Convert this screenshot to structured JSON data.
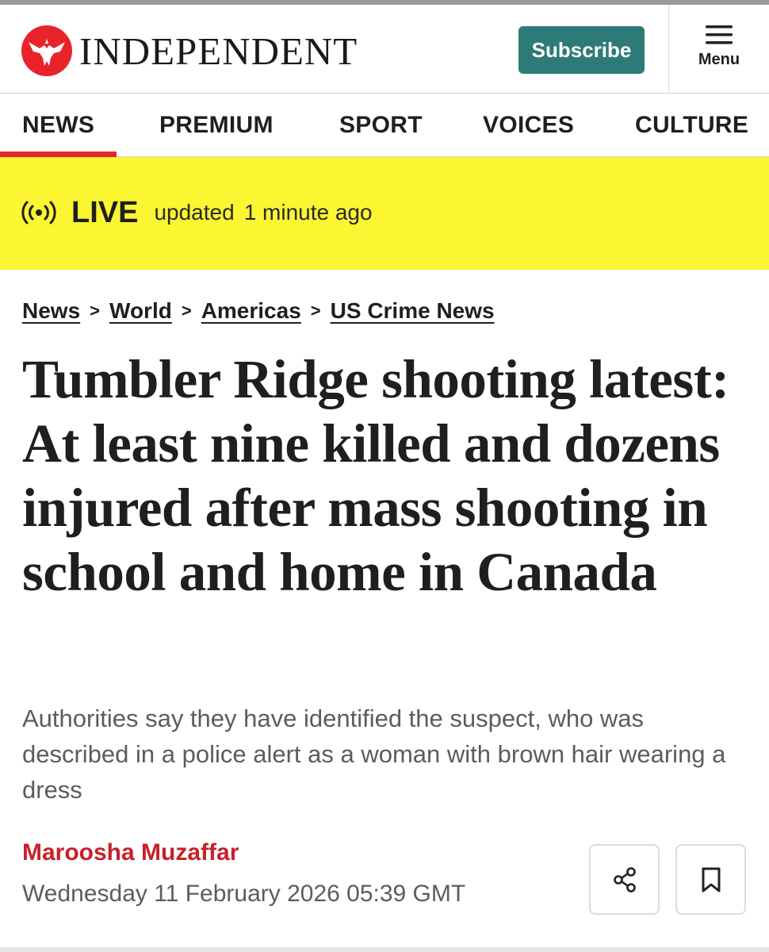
{
  "header": {
    "logo_text": "INDEPENDENT",
    "logo_icon": "eagle-logo-icon",
    "subscribe_label": "Subscribe",
    "menu_label": "Menu",
    "menu_icon": "hamburger-icon"
  },
  "nav": {
    "items": [
      {
        "label": "NEWS",
        "active": true
      },
      {
        "label": "PREMIUM",
        "active": false
      },
      {
        "label": "SPORT",
        "active": false
      },
      {
        "label": "VOICES",
        "active": false
      },
      {
        "label": "CULTURE",
        "active": false
      }
    ]
  },
  "live": {
    "icon": "broadcast-icon",
    "label": "LIVE",
    "updated_text": "updated",
    "time_text": "1 minute ago"
  },
  "breadcrumb": {
    "items": [
      "News",
      "World",
      "Americas",
      "US Crime News"
    ],
    "separator": ">"
  },
  "article": {
    "headline": "Tumbler Ridge shooting latest: At least nine killed and dozens injured after mass shooting in school and home in Canada",
    "standfirst": "Authorities say they have identified the suspect, who was described in a police alert as a woman with brown hair wearing a dress",
    "author": "Maroosha Muzaffar",
    "date": "Wednesday 11 February 2026 05:39 GMT",
    "share_icon": "share-icon",
    "bookmark_icon": "bookmark-icon"
  },
  "colors": {
    "brand_red": "#e8232b",
    "subscribe_teal": "#2e7a76",
    "live_yellow": "#fbf532",
    "byline_red": "#c8202a"
  }
}
